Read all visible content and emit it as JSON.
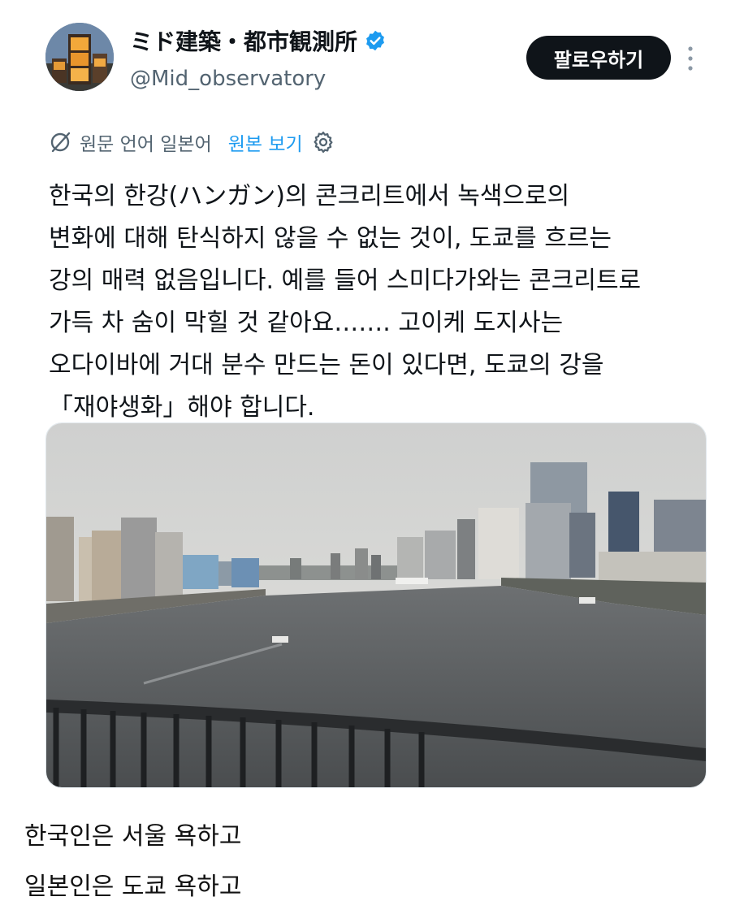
{
  "author": {
    "name": "ミド建築・都市観測所",
    "handle": "@Mid_observatory",
    "verified": true,
    "avatar_icon": "avatar-photo"
  },
  "actions": {
    "follow_label": "팔로우하기",
    "more_icon": "more-vertical-icon"
  },
  "translation": {
    "icon": "translate-icon",
    "source_label": "원문 언어 일본어",
    "show_original_label": "원본 보기",
    "settings_icon": "gear-icon"
  },
  "tweet": {
    "lines": [
      "한국의 한강(ハンガン)의 콘크리트에서 녹색으로의",
      "변화에 대해 탄식하지 않을 수 없는 것이, 도쿄를 흐르는",
      "강의 매력 없음입니다. 예를 들어 스미다가와는 콘크리트로",
      "가득 차 숨이 막힐 것 같아요……. 고이케 도지사는",
      "오다이바에 거대 분수 만드는 돈이 있다면, 도쿄의 강을",
      "「재야생화」해야 합니다."
    ],
    "image_icon": "river-photo"
  },
  "comment": {
    "lines": [
      "한국인은 서울 욕하고",
      "일본인은 도쿄 욕하고"
    ]
  },
  "colors": {
    "text": "#0f1419",
    "secondary": "#536471",
    "link": "#1d9bf0",
    "button": "#0f1419"
  }
}
